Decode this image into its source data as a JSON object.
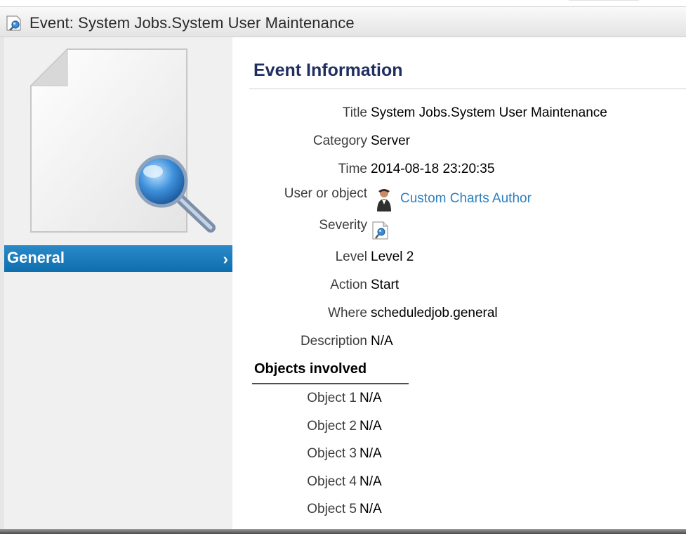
{
  "window": {
    "title": "Event: System Jobs.System User Maintenance"
  },
  "sidebar": {
    "nav_items": [
      {
        "label": "General",
        "chevron": "›",
        "selected": true
      }
    ]
  },
  "main": {
    "section_title": "Event Information",
    "fields": {
      "title": {
        "label": "Title",
        "value": "System Jobs.System User Maintenance"
      },
      "category": {
        "label": "Category",
        "value": "Server"
      },
      "time": {
        "label": "Time",
        "value": "2014-08-18 23:20:35"
      },
      "user": {
        "label": "User or object",
        "value": "Custom Charts Author"
      },
      "severity": {
        "label": "Severity",
        "icon": "event-search-icon"
      },
      "level": {
        "label": "Level",
        "value": "Level 2"
      },
      "action": {
        "label": "Action",
        "value": "Start"
      },
      "where": {
        "label": "Where",
        "value": "scheduledjob.general"
      },
      "description": {
        "label": "Description",
        "value": "N/A"
      }
    },
    "objects_header": "Objects involved",
    "objects": [
      {
        "label": "Object 1",
        "value": "N/A"
      },
      {
        "label": "Object 2",
        "value": "N/A"
      },
      {
        "label": "Object 3",
        "value": "N/A"
      },
      {
        "label": "Object 4",
        "value": "N/A"
      },
      {
        "label": "Object 5",
        "value": "N/A"
      }
    ]
  },
  "colors": {
    "nav_selected": "#1a7bbd",
    "title_text": "#1f2f60",
    "link": "#2d7fbf"
  }
}
